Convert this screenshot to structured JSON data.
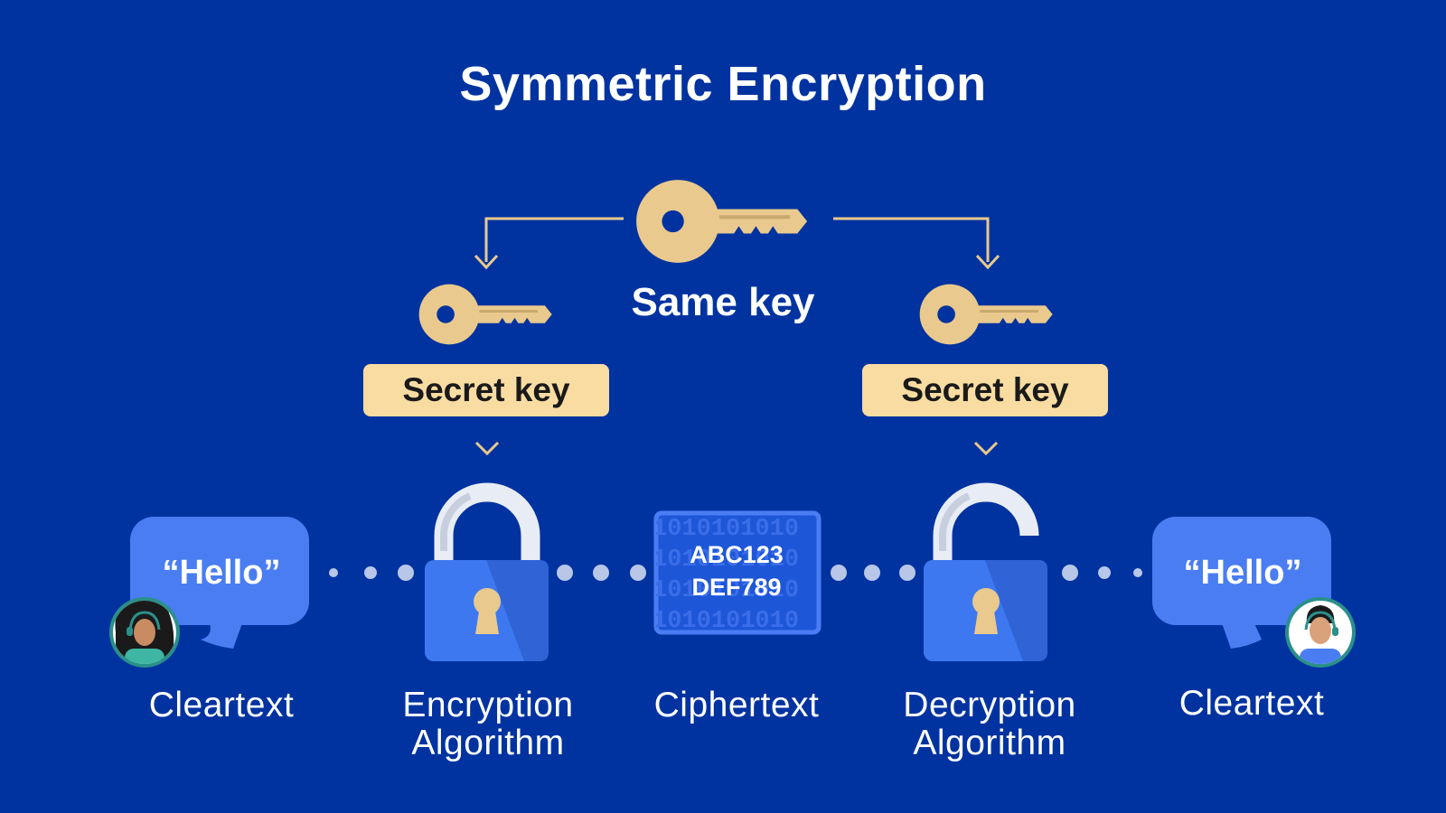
{
  "title": "Symmetric Encryption",
  "same_key_label": "Same key",
  "secret_key_label_left": "Secret key",
  "secret_key_label_right": "Secret key",
  "bubble_left_text": "“Hello”",
  "bubble_right_text": "“Hello”",
  "ciphertext_lines": [
    "ABC123",
    "DEF789"
  ],
  "ciphertext_binary": "1010101010",
  "stages": [
    {
      "label": "Cleartext"
    },
    {
      "label": "Encryption\nAlgorithm"
    },
    {
      "label": "Ciphertext"
    },
    {
      "label": "Decryption\nAlgorithm"
    },
    {
      "label": "Cleartext"
    }
  ],
  "icons": {
    "main_key": "key-icon",
    "left_key": "key-icon",
    "right_key": "key-icon",
    "enc_lock": "padlock-closed-icon",
    "dec_lock": "padlock-open-icon",
    "left_person": "woman-with-headset-avatar",
    "right_person": "man-with-headset-avatar"
  },
  "colors": {
    "background": "#0033a0",
    "key": "#e9c98d",
    "badge": "#f9dca2",
    "lock_body": "#3d78f0",
    "bubble": "#4a7df2",
    "cipher_box": "#1e56d8"
  }
}
